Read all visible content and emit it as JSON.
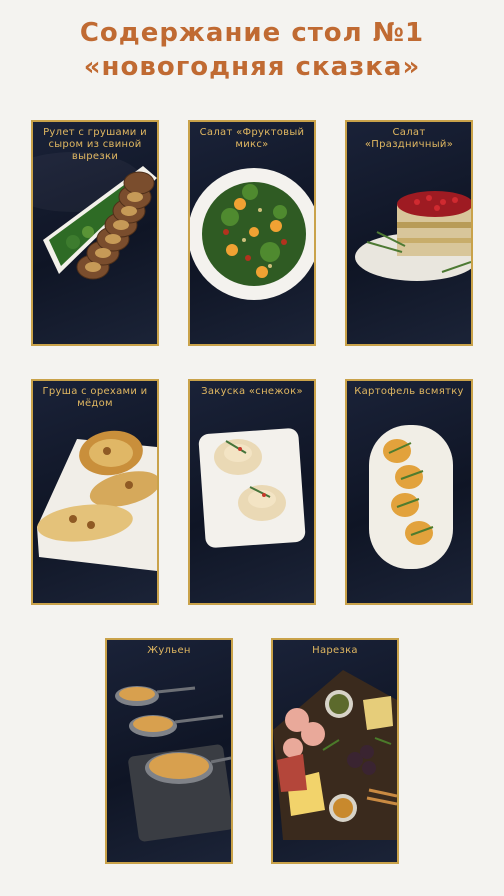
{
  "title": {
    "line1": "Содержание стол №1",
    "line2": "«новогодняя сказка»"
  },
  "dishes": [
    {
      "caption": "Рулет с грушами и сыром из свиной вырезки"
    },
    {
      "caption": "Салат «Фруктовый микс»"
    },
    {
      "caption": "Салат «Праздничный»"
    },
    {
      "caption": "Груша с орехами и мёдом"
    },
    {
      "caption": "Закуска «снежок»"
    },
    {
      "caption": "Картофель всмятку"
    },
    {
      "caption": "Жульен"
    },
    {
      "caption": "Нарезка"
    }
  ],
  "colors": {
    "accent": "#c06a32",
    "frame": "#c9a24a",
    "caption": "#e0b761",
    "card_bg": "#141b2d"
  }
}
